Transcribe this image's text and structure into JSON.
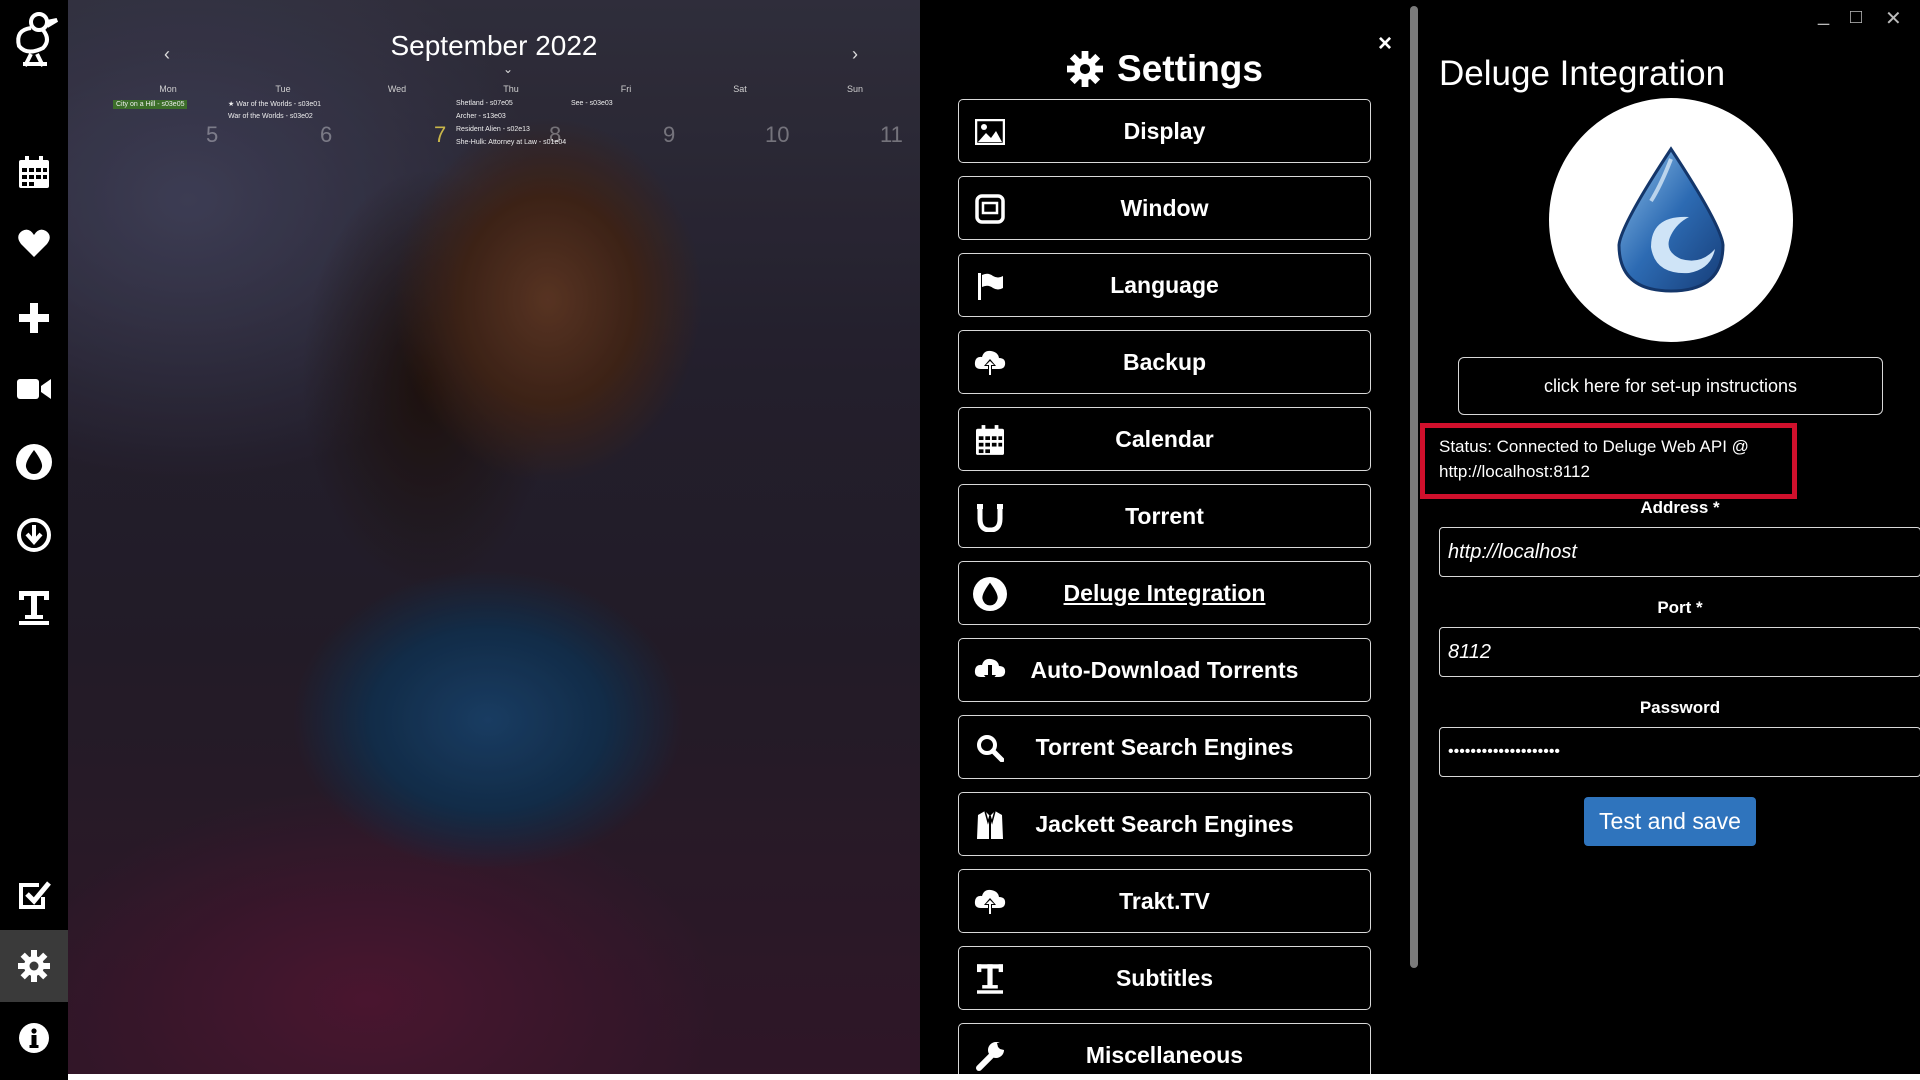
{
  "sidebar": {
    "items": [
      {
        "name": "app-logo",
        "icon": "duck-icon"
      },
      {
        "name": "calendar",
        "icon": "calendar-icon"
      },
      {
        "name": "favorites",
        "icon": "heart-icon"
      },
      {
        "name": "add",
        "icon": "plus-icon"
      },
      {
        "name": "videos",
        "icon": "video-camera-icon"
      },
      {
        "name": "deluge",
        "icon": "drop-icon"
      },
      {
        "name": "downloads",
        "icon": "download-icon"
      },
      {
        "name": "subtitles",
        "icon": "text-icon"
      },
      {
        "name": "watchlist",
        "icon": "checkbox-icon"
      },
      {
        "name": "settings",
        "icon": "gear-icon"
      },
      {
        "name": "about",
        "icon": "info-icon"
      }
    ]
  },
  "calendar": {
    "title": "September 2022",
    "prev": "‹",
    "next": "›",
    "dropdown": "⌄",
    "weekdays": [
      "Mon",
      "Tue",
      "Wed",
      "Thu",
      "Fri",
      "Sat",
      "Sun"
    ],
    "dates": [
      "5",
      "6",
      "7",
      "8",
      "9",
      "10",
      "11"
    ],
    "events": {
      "mon": [
        "City on a Hill - s03e05"
      ],
      "tue": [
        "★ War of the Worlds - s03e01",
        "War of the Worlds - s03e02"
      ],
      "thu": [
        "Shetland - s07e05",
        "Archer - s13e03",
        "Resident Alien - s02e13",
        "She-Hulk: Attorney at Law - s01e04"
      ],
      "fri": [
        "See - s03e03"
      ]
    }
  },
  "settings": {
    "title": "Settings",
    "close": "×",
    "items": [
      {
        "label": "Display",
        "icon": "image-icon"
      },
      {
        "label": "Window",
        "icon": "window-icon"
      },
      {
        "label": "Language",
        "icon": "flag-icon"
      },
      {
        "label": "Backup",
        "icon": "cloud-upload-icon"
      },
      {
        "label": "Calendar",
        "icon": "calendar-icon"
      },
      {
        "label": "Torrent",
        "icon": "magnet-icon"
      },
      {
        "label": "Deluge Integration",
        "icon": "deluge-drop-icon",
        "active": true
      },
      {
        "label": "Auto-Download Torrents",
        "icon": "cloud-download-icon"
      },
      {
        "label": "Torrent Search Engines",
        "icon": "search-icon"
      },
      {
        "label": "Jackett Search Engines",
        "icon": "jacket-icon"
      },
      {
        "label": "Trakt.TV",
        "icon": "cloud-upload-icon"
      },
      {
        "label": "Subtitles",
        "icon": "text-icon"
      },
      {
        "label": "Miscellaneous",
        "icon": "wrench-icon"
      }
    ]
  },
  "panel": {
    "title": "Deluge Integration",
    "setup_button": "click here for set-up instructions",
    "status": "Status: Connected to Deluge Web API @ http://localhost:8112",
    "address_label": "Address *",
    "address_value": "http://localhost",
    "port_label": "Port *",
    "port_value": "8112",
    "password_label": "Password",
    "password_value": "••••••••••••••••••••",
    "save_button": "Test and save",
    "window_controls": [
      "_",
      "□",
      "✕"
    ],
    "accent_color": "#2f74bd",
    "status_border_color": "#d0102c"
  }
}
